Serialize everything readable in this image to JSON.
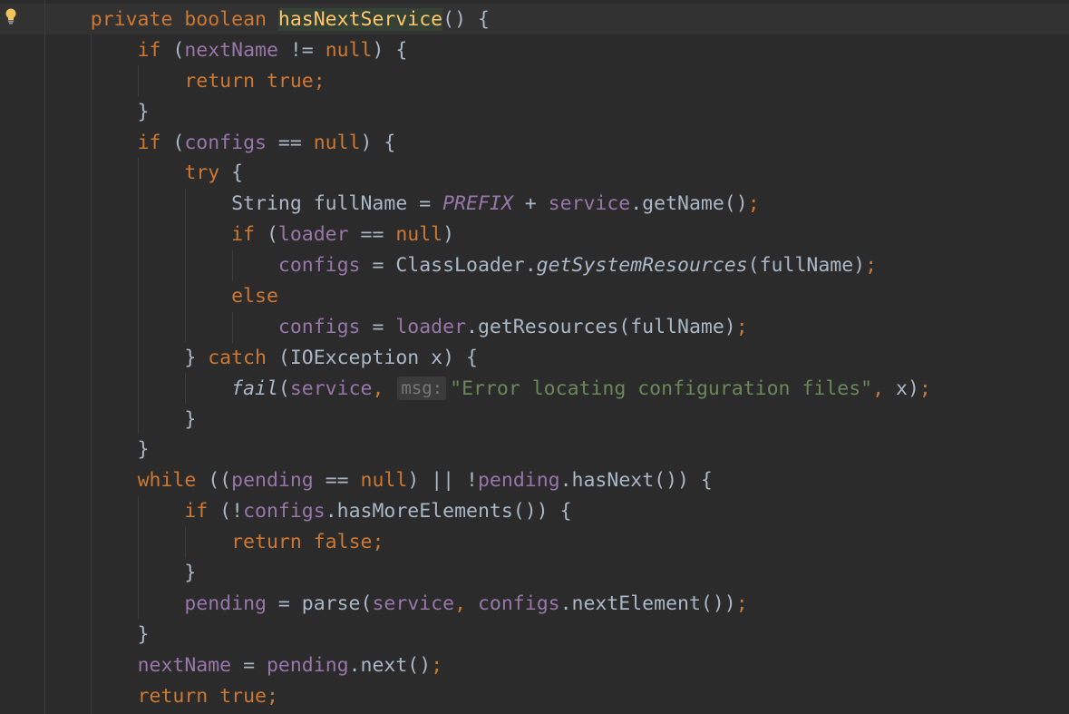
{
  "editor": {
    "lines": [
      [
        {
          "t": "    "
        },
        {
          "t": "private",
          "c": "kw"
        },
        {
          "t": " "
        },
        {
          "t": "boolean",
          "c": "kw"
        },
        {
          "t": " "
        },
        {
          "t": "hasNextService",
          "c": "fn"
        },
        {
          "t": "() {"
        }
      ],
      [
        {
          "t": "        "
        },
        {
          "t": "if",
          "c": "kw"
        },
        {
          "t": " ("
        },
        {
          "t": "nextName",
          "c": "fld"
        },
        {
          "t": " != "
        },
        {
          "t": "null",
          "c": "kw"
        },
        {
          "t": ") {"
        }
      ],
      [
        {
          "t": "            "
        },
        {
          "t": "return",
          "c": "kw"
        },
        {
          "t": " "
        },
        {
          "t": "true",
          "c": "kw"
        },
        {
          "t": ";",
          "c": "kw"
        }
      ],
      [
        {
          "t": "        }"
        }
      ],
      [
        {
          "t": "        "
        },
        {
          "t": "if",
          "c": "kw"
        },
        {
          "t": " ("
        },
        {
          "t": "configs",
          "c": "fld"
        },
        {
          "t": " == "
        },
        {
          "t": "null",
          "c": "kw"
        },
        {
          "t": ") {"
        }
      ],
      [
        {
          "t": "            "
        },
        {
          "t": "try",
          "c": "kw"
        },
        {
          "t": " {"
        }
      ],
      [
        {
          "t": "                String fullName = "
        },
        {
          "t": "PREFIX",
          "c": "st"
        },
        {
          "t": " + "
        },
        {
          "t": "service",
          "c": "fld"
        },
        {
          "t": ".getName()"
        },
        {
          "t": ";",
          "c": "kw"
        }
      ],
      [
        {
          "t": "                "
        },
        {
          "t": "if",
          "c": "kw"
        },
        {
          "t": " ("
        },
        {
          "t": "loader",
          "c": "fld"
        },
        {
          "t": " == "
        },
        {
          "t": "null",
          "c": "kw"
        },
        {
          "t": ")"
        }
      ],
      [
        {
          "t": "                    "
        },
        {
          "t": "configs",
          "c": "fld"
        },
        {
          "t": " = ClassLoader."
        },
        {
          "t": "getSystemResources",
          "c": "it"
        },
        {
          "t": "(fullName)"
        },
        {
          "t": ";",
          "c": "kw"
        }
      ],
      [
        {
          "t": "                "
        },
        {
          "t": "else",
          "c": "kw"
        }
      ],
      [
        {
          "t": "                    "
        },
        {
          "t": "configs",
          "c": "fld"
        },
        {
          "t": " = "
        },
        {
          "t": "loader",
          "c": "fld"
        },
        {
          "t": ".getResources(fullName)"
        },
        {
          "t": ";",
          "c": "kw"
        }
      ],
      [
        {
          "t": "            } "
        },
        {
          "t": "catch",
          "c": "kw"
        },
        {
          "t": " (IOException x) {"
        }
      ],
      [
        {
          "t": "                "
        },
        {
          "t": "fail",
          "c": "it"
        },
        {
          "t": "("
        },
        {
          "t": "service",
          "c": "fld"
        },
        {
          "t": ",",
          "c": "kw"
        },
        {
          "t": " "
        },
        {
          "t": "msg:",
          "c": "hint"
        },
        {
          "t": "\"Error locating configuration files\"",
          "c": "str"
        },
        {
          "t": ",",
          "c": "kw"
        },
        {
          "t": " x)"
        },
        {
          "t": ";",
          "c": "kw"
        }
      ],
      [
        {
          "t": "            }"
        }
      ],
      [
        {
          "t": "        }"
        }
      ],
      [
        {
          "t": "        "
        },
        {
          "t": "while",
          "c": "kw"
        },
        {
          "t": " (("
        },
        {
          "t": "pending",
          "c": "fld"
        },
        {
          "t": " == "
        },
        {
          "t": "null",
          "c": "kw"
        },
        {
          "t": ") || !"
        },
        {
          "t": "pending",
          "c": "fld"
        },
        {
          "t": ".hasNext()) {"
        }
      ],
      [
        {
          "t": "            "
        },
        {
          "t": "if",
          "c": "kw"
        },
        {
          "t": " (!"
        },
        {
          "t": "configs",
          "c": "fld"
        },
        {
          "t": ".hasMoreElements()) {"
        }
      ],
      [
        {
          "t": "                "
        },
        {
          "t": "return",
          "c": "kw"
        },
        {
          "t": " "
        },
        {
          "t": "false",
          "c": "kw"
        },
        {
          "t": ";",
          "c": "kw"
        }
      ],
      [
        {
          "t": "            }"
        }
      ],
      [
        {
          "t": "            "
        },
        {
          "t": "pending",
          "c": "fld"
        },
        {
          "t": " = parse("
        },
        {
          "t": "service",
          "c": "fld"
        },
        {
          "t": ",",
          "c": "kw"
        },
        {
          "t": " "
        },
        {
          "t": "configs",
          "c": "fld"
        },
        {
          "t": ".nextElement())"
        },
        {
          "t": ";",
          "c": "kw"
        }
      ],
      [
        {
          "t": "        }"
        }
      ],
      [
        {
          "t": "        "
        },
        {
          "t": "nextName",
          "c": "fld"
        },
        {
          "t": " = "
        },
        {
          "t": "pending",
          "c": "fld"
        },
        {
          "t": ".next()"
        },
        {
          "t": ";",
          "c": "kw"
        }
      ],
      [
        {
          "t": "        "
        },
        {
          "t": "return",
          "c": "kw"
        },
        {
          "t": " "
        },
        {
          "t": "true",
          "c": "kw"
        },
        {
          "t": ";",
          "c": "kw"
        }
      ]
    ]
  },
  "icons": {
    "intention": "lightbulb-icon"
  },
  "colors": {
    "background": "#2b2b2b",
    "keyword": "#cc7832",
    "field": "#9876aa",
    "string": "#6a8759",
    "method_declaration": "#ffc66d",
    "default_text": "#a9b7c6"
  }
}
